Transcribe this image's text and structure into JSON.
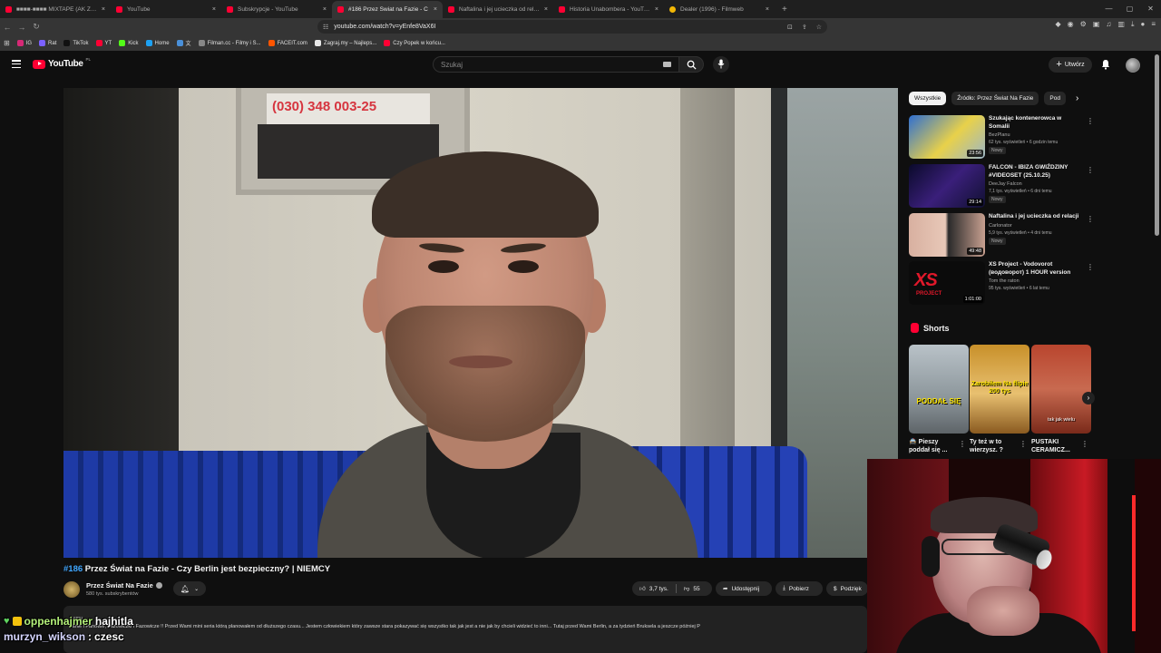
{
  "browser": {
    "tabs": [
      {
        "title": "■■■■-■■■■ MIXTAPE (AK ZA DI",
        "fav": "yt",
        "active": false
      },
      {
        "title": "YouTube",
        "fav": "yt",
        "active": false
      },
      {
        "title": "Subskrypcje - YouTube",
        "fav": "yt",
        "active": false
      },
      {
        "title": "#186 Przez Świat na Fazie - C",
        "fav": "yt",
        "active": true
      },
      {
        "title": "Naftalina i jej ucieczka od relacji - Yo",
        "fav": "yt",
        "active": false
      },
      {
        "title": "Historia Unabombera - YouTube",
        "fav": "yt",
        "active": false
      },
      {
        "title": "Dealer (1996) - Filmweb",
        "fav": "fw",
        "active": false
      }
    ],
    "new_tab": "+",
    "url": "youtube.com/watch?v=yEnfe8VaX6I",
    "bookmarks": [
      {
        "label": "IG",
        "color": "#d62976"
      },
      {
        "label": "Rat",
        "color": "#7b61ff"
      },
      {
        "label": "TikTok",
        "color": "#111111"
      },
      {
        "label": "YT",
        "color": "#ff0033"
      },
      {
        "label": "Kick",
        "color": "#53fc18"
      },
      {
        "label": "Home",
        "color": "#1da1f2"
      },
      {
        "label": "文",
        "color": "#4a90d9"
      },
      {
        "label": "Filman.cc - Filmy i S...",
        "color": "#888888"
      },
      {
        "label": "FACEIT.com",
        "color": "#ff5500"
      },
      {
        "label": "Zagraj.my – Najleps...",
        "color": "#e8e8e8"
      },
      {
        "label": "Czy Popek w końcu...",
        "color": "#ff0033"
      }
    ]
  },
  "header": {
    "logo": "YouTube",
    "country": "PL",
    "search_placeholder": "Szukaj",
    "create_label": "Utwórz"
  },
  "video": {
    "poster_text": "(030) 348 003-25",
    "hashtag": "#186",
    "title": "Przez Świat na Fazie - Czy Berlin jest bezpieczny? | NIEMCY",
    "channel": "Przez Świat Na Fazie",
    "subscribers": "580 tys. subskrybentów",
    "likes": "3,7 tys.",
    "comments": "55",
    "share_label": "Udostępnij",
    "download_label": "Pobierz",
    "thanks_label": "Podzięk",
    "desc_meta": "...emu",
    "description": "Panie i Panowie, Fazowiczki i Fazowicze !! Przed Wami mini seria którą planowałem od dłuższego czasu... Jestem człowiekiem który zawsze stara pokazywać się wszystko tak jak jest a nie jak by chcieli widzieć to inni... Tutaj przed Wami Berlin, a za tydzień Bruksela a jeszcze później P"
  },
  "sidebar": {
    "chips": [
      "Wszystkie",
      "Źródło: Przez Świat Na Fazie",
      "Pod"
    ],
    "recommendations": [
      {
        "title": "Szukając kontenerowca w Somalii",
        "channel": "BezPlanu",
        "meta": "62 tys. wyświetleń • 6 godzin temu",
        "badge": "Nowy",
        "duration": "23:56"
      },
      {
        "title": "FALCON - IBIZA GWIŹDZINY #VIDEOSET (25.10.25)",
        "channel": "DeeJay Falcon",
        "meta": "7,1 tys. wyświetleń • 6 dni temu",
        "badge": "Nowy",
        "duration": "29:14"
      },
      {
        "title": "Naftalina i jej ucieczka od relacji",
        "channel": "Carlonator",
        "meta": "5,9 tys. wyświetleń • 4 dni temu",
        "badge": "Nowy",
        "duration": "49:48"
      },
      {
        "title": "XS Project - Vodovorot (водоворот) 1 HOUR version",
        "channel": "Tom the raton",
        "meta": "95 tys. wyświetleń • 6 lat temu",
        "badge": "",
        "duration": "1:01:00"
      }
    ],
    "thumb4_text": "XS",
    "thumb4_sub": "PROJECT",
    "shorts_heading": "Shorts",
    "shorts": [
      {
        "caption": "PODDAŁ SIĘ",
        "title": "🚔 Pieszy poddał się ..."
      },
      {
        "caption": "Zarobiłem Na flipie 200 tys",
        "title": "Ty też w to wierzysz. ?"
      },
      {
        "caption": "tak jak wielu",
        "title": "PUSTAKI CERAMICZ..."
      }
    ]
  },
  "chat": [
    {
      "user": "oppenhajmer",
      "message": "hajhitla"
    },
    {
      "user": "murzyn_wikson",
      "message": "czesc"
    }
  ]
}
